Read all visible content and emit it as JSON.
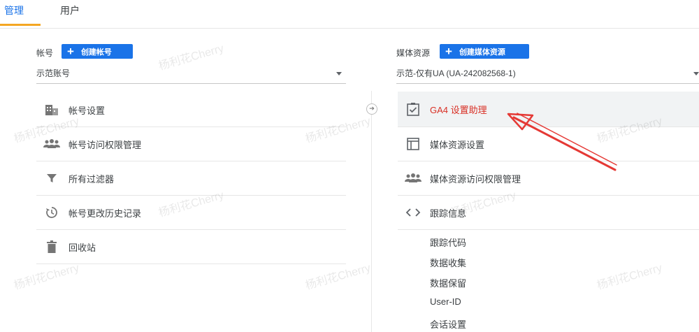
{
  "tabs": [
    {
      "label": "管理",
      "active": true
    },
    {
      "label": "用户",
      "active": false
    }
  ],
  "account": {
    "label": "帐号",
    "create_button": "创建帐号",
    "selected": "示范账号",
    "items": [
      {
        "label": "帐号设置",
        "icon": "building-icon"
      },
      {
        "label": "帐号访问权限管理",
        "icon": "people-icon"
      },
      {
        "label": "所有过滤器",
        "icon": "filter-icon"
      },
      {
        "label": "帐号更改历史记录",
        "icon": "history-icon"
      },
      {
        "label": "回收站",
        "icon": "trash-icon"
      }
    ]
  },
  "property": {
    "label": "媒体资源",
    "create_button": "创建媒体资源",
    "selected": "示范-仅有UA (UA-242082568-1)",
    "items": [
      {
        "label": "GA4 设置助理",
        "icon": "checkbox-icon",
        "highlighted": true
      },
      {
        "label": "媒体资源设置",
        "icon": "window-icon"
      },
      {
        "label": "媒体资源访问权限管理",
        "icon": "people-icon"
      },
      {
        "label": "跟踪信息",
        "icon": "code-icon"
      }
    ],
    "tracking_subitems": [
      "跟踪代码",
      "数据收集",
      "数据保留",
      "User-ID",
      "会话设置"
    ]
  },
  "watermark_text": "杨利花Cherry",
  "colors": {
    "accent_blue": "#1a73e8",
    "tab_underline": "#f4a623",
    "highlight_red": "#d93025",
    "annotation_arrow": "#e53935"
  }
}
